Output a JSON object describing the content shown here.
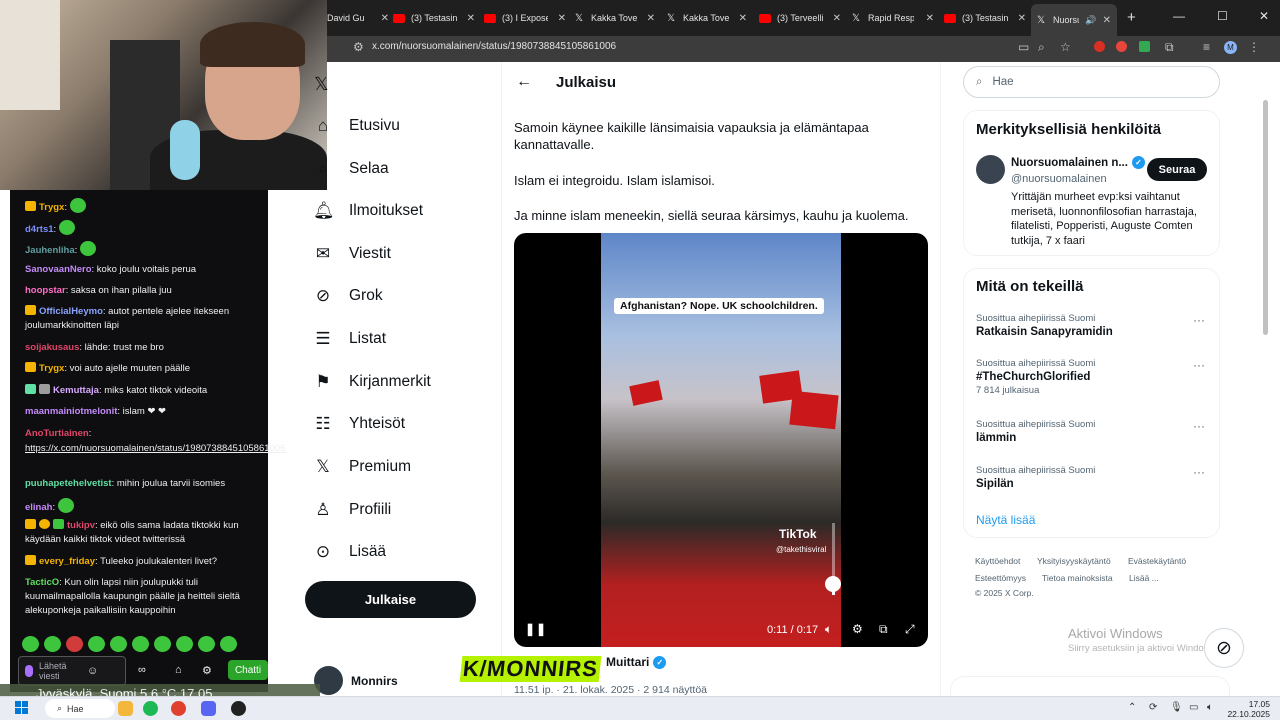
{
  "browser": {
    "tabs": [
      {
        "label": "David Gu",
        "icon": "x-logo-icon"
      },
      {
        "label": "(3) Testasin l",
        "icon": "youtube-icon"
      },
      {
        "label": "(3) I Expose",
        "icon": "youtube-icon"
      },
      {
        "label": "Kakka Tover",
        "icon": "x-logo-icon"
      },
      {
        "label": "Kakka Tover",
        "icon": "x-logo-icon"
      },
      {
        "label": "(3) Terveellis",
        "icon": "youtube-icon"
      },
      {
        "label": "Rapid Respo",
        "icon": "x-logo-icon"
      },
      {
        "label": "(3) Testasin l",
        "icon": "youtube-icon"
      },
      {
        "label": "Nuorsu",
        "icon": "x-logo-icon",
        "active": true
      }
    ],
    "url": "x.com/nuorsuomalainen/status/1980738845105861006",
    "profile_initial": "M"
  },
  "chat": {
    "messages": [
      {
        "user": "Trygx",
        "color": "#f5b400",
        "text": ":",
        "badge": true,
        "emote": true
      },
      {
        "user": "d4rts1",
        "color": "#7c8ff7",
        "text": ":",
        "emote": true
      },
      {
        "user": "Jauhenliha",
        "color": "#5f9ea0",
        "text": ":",
        "emote": true
      },
      {
        "user": "SanovaanNero",
        "color": "#c58af9",
        "text": ": koko joulu voitais perua"
      },
      {
        "user": "hoopstar",
        "color": "#ff6ec7",
        "text": ": saksa on ihan pilalla juu"
      },
      {
        "user": "OfficialHeymo",
        "color": "#8aa4ff",
        "text": ": autot pentele ajelee itekseen joulumarkkinoitten läpi",
        "badge": true
      },
      {
        "user": "soijakusaus",
        "color": "#e0456a",
        "text": ": lähde: trust me bro"
      },
      {
        "user": "Trygx",
        "color": "#f5b400",
        "text": ": voi auto ajelle muuten päälle",
        "badge": true
      },
      {
        "user": "Kemuttaja",
        "color": "#d6a8ff",
        "text": ": miks katot tiktok videoita"
      },
      {
        "user": "maanmainiotmelonit",
        "color": "#c58af9",
        "text": ": islam ❤ ❤"
      },
      {
        "user": "AnoTurtiainen",
        "color": "#e0456a",
        "text": ":"
      },
      {
        "user": "",
        "color": "#efeff1",
        "text": "https://x.com/nuorsuomalainen/status/1980738845105861006",
        "link": true
      },
      {
        "user": "puuhapetehelvetist",
        "color": "#5fe0a4",
        "text": ": mihin joulua tarvii isomies"
      },
      {
        "user": "elinah",
        "color": "#c58af9",
        "text": ":",
        "emote": true
      },
      {
        "user": "tukipv",
        "color": "#e0456a",
        "text": ": eikö olis sama ladata tiktokki kun käydään kaikki tiktok videot twitterissä",
        "badge": true
      },
      {
        "user": "every_friday",
        "color": "#f5b400",
        "text": ": Tuleeko joulukalenteri livet?"
      },
      {
        "user": "TacticO",
        "color": "#5fe05f",
        "text": ": Kun olin lapsi niin joulupukki tuli kuumailmapallolla kaupungin päälle ja heitteli sieltä alekuponkeja paikallisiin kauppoihin"
      }
    ],
    "input_placeholder": "Lähetä viesti",
    "send_label": "Chatti",
    "weather": "Jyväskylä, Suomi  5.6 °C  17.05"
  },
  "nav": {
    "items": [
      {
        "label": "Etusivu",
        "icon": "home-icon"
      },
      {
        "label": "Selaa",
        "icon": "explore-icon"
      },
      {
        "label": "Ilmoitukset",
        "icon": "bell-icon"
      },
      {
        "label": "Viestit",
        "icon": "mail-icon"
      },
      {
        "label": "Grok",
        "icon": "grok-icon"
      },
      {
        "label": "Listat",
        "icon": "list-icon"
      },
      {
        "label": "Kirjanmerkit",
        "icon": "bookmark-icon"
      },
      {
        "label": "Yhteisöt",
        "icon": "communities-icon"
      },
      {
        "label": "Premium",
        "icon": "x-logo-icon"
      },
      {
        "label": "Profiili",
        "icon": "person-icon"
      },
      {
        "label": "Lisää",
        "icon": "more-icon"
      }
    ],
    "post_button": "Julkaise",
    "account_name": "Monnirs"
  },
  "post": {
    "header": "Julkaisu",
    "paragraphs": [
      "Samoin käynee kaikille länsimaisia vapauksia ja elämäntapaa kannattavalle.",
      "Islam ei integroidu. Islam islamisoi.",
      "Ja minne islam meneekin, siellä seuraa kärsimys, kauhu ja kuolema."
    ],
    "video": {
      "caption": "Afghanistan? Nope. UK schoolchildren.",
      "watermark": "TikTok",
      "watermark_user": "@takethisviral",
      "time": "0:11 / 0:17",
      "progress": 0.647,
      "volume": 0.15
    },
    "quoted_author": "Muittari",
    "timestamp": "11.51 ip. · 21. lokak. 2025 · 2 914 näyttöä"
  },
  "overlay_logo": "K/MONNIRS",
  "sidebar": {
    "search_placeholder": "Hae",
    "who_title": "Merkityksellisiä henkilöitä",
    "who": {
      "name": "Nuorsuomalainen n...",
      "handle": "@nuorsuomalainen",
      "bio": "Yrittäjän murheet evp:ksi vaihtanut merisetä, luonnonfilosofian harrastaja, filatelisti, Popperisti, Auguste Comten tutkija, 7 x faari",
      "follow_label": "Seuraa"
    },
    "trends_title": "Mitä on tekeillä",
    "trends": [
      {
        "category": "Suosittua aihepiirissä Suomi",
        "name": "Ratkaisin Sanapyramidin",
        "count": ""
      },
      {
        "category": "Suosittua aihepiirissä Suomi",
        "name": "#TheChurchGlorified",
        "count": "7 814 julkaisua"
      },
      {
        "category": "Suosittua aihepiirissä Suomi",
        "name": "lämmin",
        "count": ""
      },
      {
        "category": "Suosittua aihepiirissä Suomi",
        "name": "Sipilän",
        "count": ""
      }
    ],
    "show_more": "Näytä lisää",
    "footer": [
      "Käyttöehdot",
      "Yksityisyyskäytäntö",
      "Evästekäytäntö",
      "Esteettömyys",
      "Tietoa mainoksista",
      "Lisää ...",
      "© 2025 X Corp."
    ]
  },
  "windows": {
    "activate_title": "Aktivoi Windows",
    "activate_sub": "Siirry asetuksiin ja aktivoi Windows.",
    "taskbar_search": "Hae",
    "time": "17.05",
    "date": "22.10.2025"
  }
}
